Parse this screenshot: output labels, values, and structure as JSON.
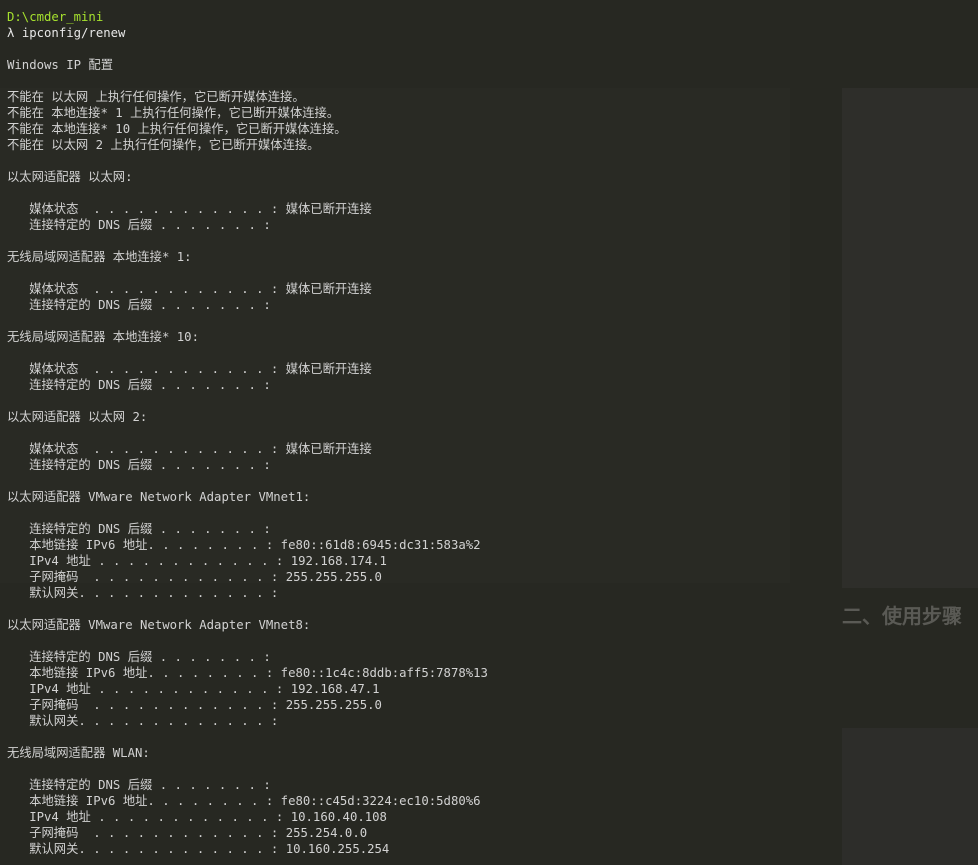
{
  "prompt": {
    "path": "D:\\cmder_mini",
    "lambda": "λ",
    "command": "ipconfig/renew"
  },
  "background_heading": "二、使用步骤",
  "output_lines": [
    "",
    "Windows IP 配置",
    "",
    "不能在 以太网 上执行任何操作，它已断开媒体连接。",
    "不能在 本地连接* 1 上执行任何操作，它已断开媒体连接。",
    "不能在 本地连接* 10 上执行任何操作，它已断开媒体连接。",
    "不能在 以太网 2 上执行任何操作，它已断开媒体连接。",
    "",
    "以太网适配器 以太网:",
    "",
    "   媒体状态  . . . . . . . . . . . . : 媒体已断开连接",
    "   连接特定的 DNS 后缀 . . . . . . . :",
    "",
    "无线局域网适配器 本地连接* 1:",
    "",
    "   媒体状态  . . . . . . . . . . . . : 媒体已断开连接",
    "   连接特定的 DNS 后缀 . . . . . . . :",
    "",
    "无线局域网适配器 本地连接* 10:",
    "",
    "   媒体状态  . . . . . . . . . . . . : 媒体已断开连接",
    "   连接特定的 DNS 后缀 . . . . . . . :",
    "",
    "以太网适配器 以太网 2:",
    "",
    "   媒体状态  . . . . . . . . . . . . : 媒体已断开连接",
    "   连接特定的 DNS 后缀 . . . . . . . :",
    "",
    "以太网适配器 VMware Network Adapter VMnet1:",
    "",
    "   连接特定的 DNS 后缀 . . . . . . . :",
    "   本地链接 IPv6 地址. . . . . . . . : fe80::61d8:6945:dc31:583a%2",
    "   IPv4 地址 . . . . . . . . . . . . : 192.168.174.1",
    "   子网掩码  . . . . . . . . . . . . : 255.255.255.0",
    "   默认网关. . . . . . . . . . . . . :",
    "",
    "以太网适配器 VMware Network Adapter VMnet8:",
    "",
    "   连接特定的 DNS 后缀 . . . . . . . :",
    "   本地链接 IPv6 地址. . . . . . . . : fe80::1c4c:8ddb:aff5:7878%13",
    "   IPv4 地址 . . . . . . . . . . . . : 192.168.47.1",
    "   子网掩码  . . . . . . . . . . . . : 255.255.255.0",
    "   默认网关. . . . . . . . . . . . . :",
    "",
    "无线局域网适配器 WLAN:",
    "",
    "   连接特定的 DNS 后缀 . . . . . . . :",
    "   本地链接 IPv6 地址. . . . . . . . : fe80::c45d:3224:ec10:5d80%6",
    "   IPv4 地址 . . . . . . . . . . . . : 10.160.40.108",
    "   子网掩码  . . . . . . . . . . . . : 255.254.0.0",
    "   默认网关. . . . . . . . . . . . . : 10.160.255.254"
  ],
  "colors": {
    "background": "#272822",
    "text": "#d2d2d2",
    "prompt_path": "#a6e22e"
  }
}
